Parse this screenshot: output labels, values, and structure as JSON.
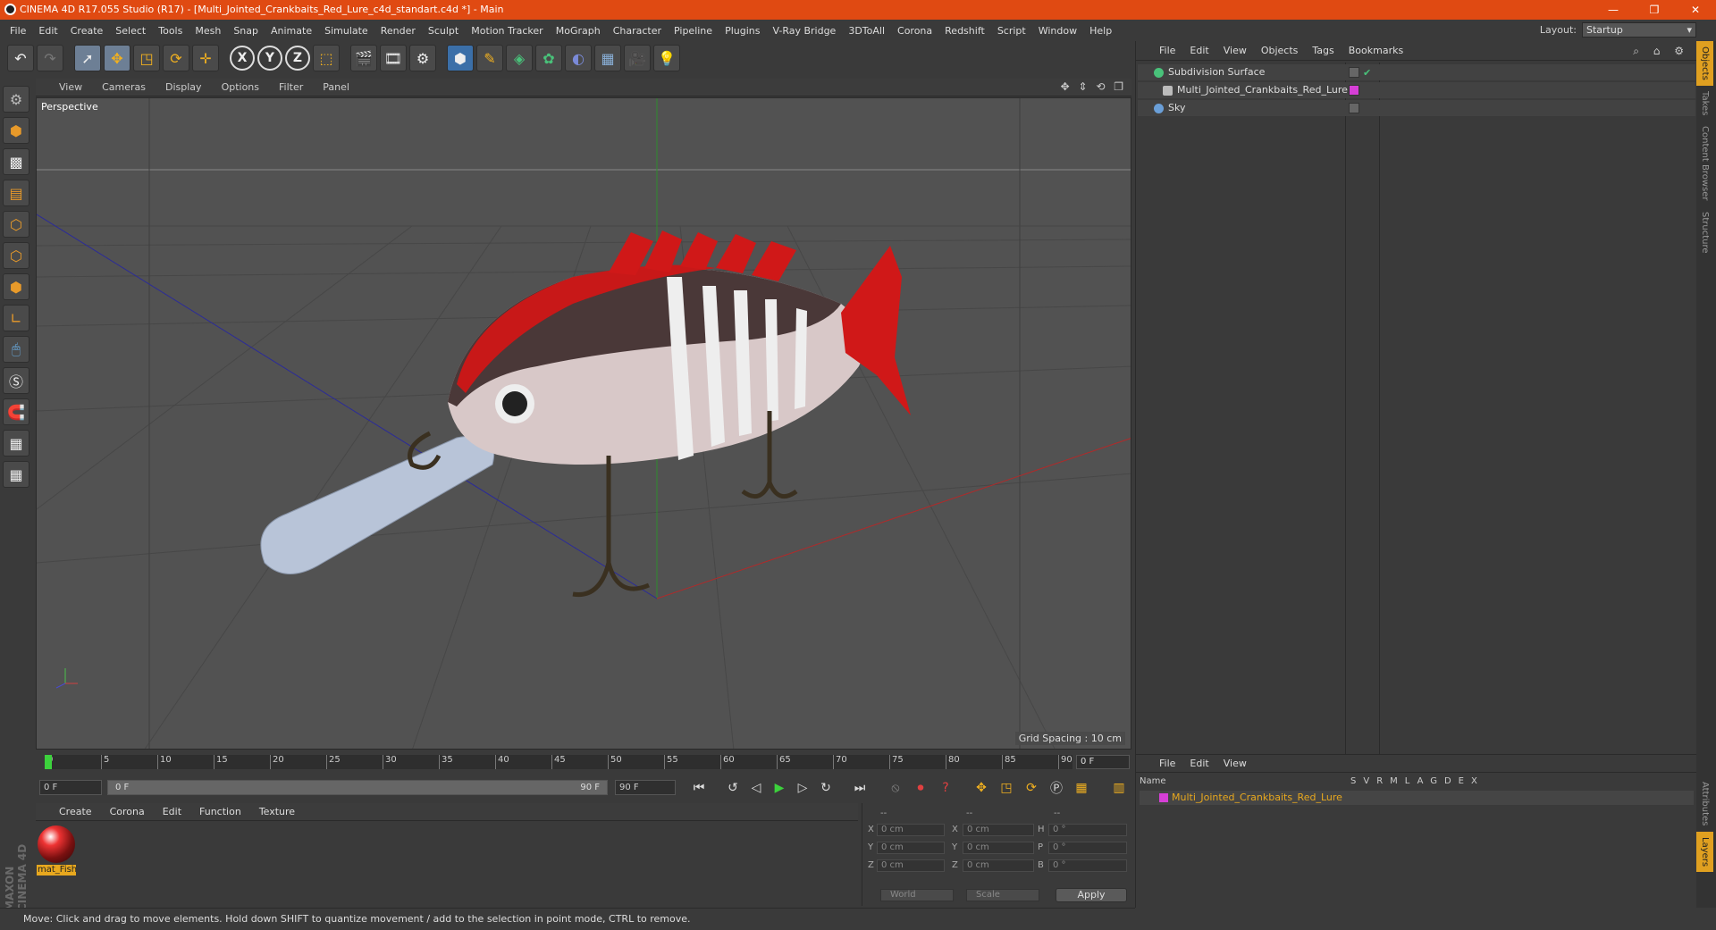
{
  "window": {
    "title": "CINEMA 4D R17.055 Studio (R17) - [Multi_Jointed_Crankbaits_Red_Lure_c4d_standart.c4d *] - Main",
    "controls": [
      "—",
      "❐",
      "✕"
    ]
  },
  "menubar": {
    "items": [
      "File",
      "Edit",
      "Create",
      "Select",
      "Tools",
      "Mesh",
      "Snap",
      "Animate",
      "Simulate",
      "Render",
      "Sculpt",
      "Motion Tracker",
      "MoGraph",
      "Character",
      "Pipeline",
      "Plugins",
      "V-Ray Bridge",
      "3DToAll",
      "Corona",
      "Redshift",
      "Script",
      "Window",
      "Help"
    ],
    "layout_label": "Layout:",
    "layout_value": "Startup"
  },
  "toolbar": {
    "icons": [
      "undo-icon",
      "redo-icon",
      "select-icon",
      "move-icon",
      "scale-icon",
      "rotate-icon",
      "transform-icon",
      "x-axis-icon",
      "y-axis-icon",
      "z-axis-icon",
      "world-coords-icon",
      "render-view-icon",
      "render-pv-icon",
      "render-settings-icon",
      "cube-icon",
      "pen-icon",
      "subdivision-icon",
      "cloner-icon",
      "deformer-icon",
      "floor-icon",
      "camera-icon",
      "light-icon"
    ],
    "axis_labels": [
      "X",
      "Y",
      "Z"
    ]
  },
  "viewport": {
    "menu": [
      "View",
      "Cameras",
      "Display",
      "Options",
      "Filter",
      "Panel"
    ],
    "label": "Perspective",
    "grid_spacing": "Grid Spacing : 10 cm",
    "nav_icons": "✥ ⇕ ⟲ ❐"
  },
  "timeline": {
    "ticks": [
      "0",
      "5",
      "10",
      "15",
      "20",
      "25",
      "30",
      "35",
      "40",
      "45",
      "50",
      "55",
      "60",
      "65",
      "70",
      "75",
      "80",
      "85",
      "90"
    ],
    "current_frame": "0 F"
  },
  "transport": {
    "start": "0 F",
    "range_start": "0 F",
    "range_end": "90 F",
    "end": "90 F"
  },
  "material_manager": {
    "menu": [
      "Create",
      "Corona",
      "Edit",
      "Function",
      "Texture"
    ],
    "material_name": "mat_Fish"
  },
  "coordinates": {
    "headers": [
      "--",
      "--",
      "--"
    ],
    "rows": [
      {
        "a": "X",
        "av": "0 cm",
        "b": "X",
        "bv": "0 cm",
        "c": "H",
        "cv": "0 °"
      },
      {
        "a": "Y",
        "av": "0 cm",
        "b": "Y",
        "bv": "0 cm",
        "c": "P",
        "cv": "0 °"
      },
      {
        "a": "Z",
        "av": "0 cm",
        "b": "Z",
        "bv": "0 cm",
        "c": "B",
        "cv": "0 °"
      }
    ],
    "mode": "World",
    "type": "Scale",
    "apply": "Apply"
  },
  "statusbar": {
    "text": "Move: Click and drag to move elements. Hold down SHIFT to quantize movement / add to the selection in point mode, CTRL to remove."
  },
  "object_manager": {
    "menu": [
      "File",
      "Edit",
      "View",
      "Objects",
      "Tags",
      "Bookmarks"
    ],
    "objects": [
      {
        "name": "Subdivision Surface",
        "color": "#49c27a"
      },
      {
        "name": "Multi_Jointed_Crankbaits_Red_Lure",
        "color": "#bbbbbb"
      },
      {
        "name": "Sky",
        "color": "#6a9fd8"
      }
    ]
  },
  "side_tabs": [
    "Objects",
    "Takes",
    "Content Browser",
    "Structure",
    "Attributes",
    "Layers"
  ],
  "layer_manager": {
    "menu": [
      "File",
      "Edit",
      "View"
    ],
    "name_header": "Name",
    "columns": "SVRMLAGDEX",
    "layer_name": "Multi_Jointed_Crankbaits_Red_Lure"
  },
  "maxon": {
    "logo": "MAXON CINEMA 4D"
  },
  "colors": {
    "accent": "#e04a12",
    "layer": "#e8a81e",
    "selected": "#3cd23c"
  }
}
